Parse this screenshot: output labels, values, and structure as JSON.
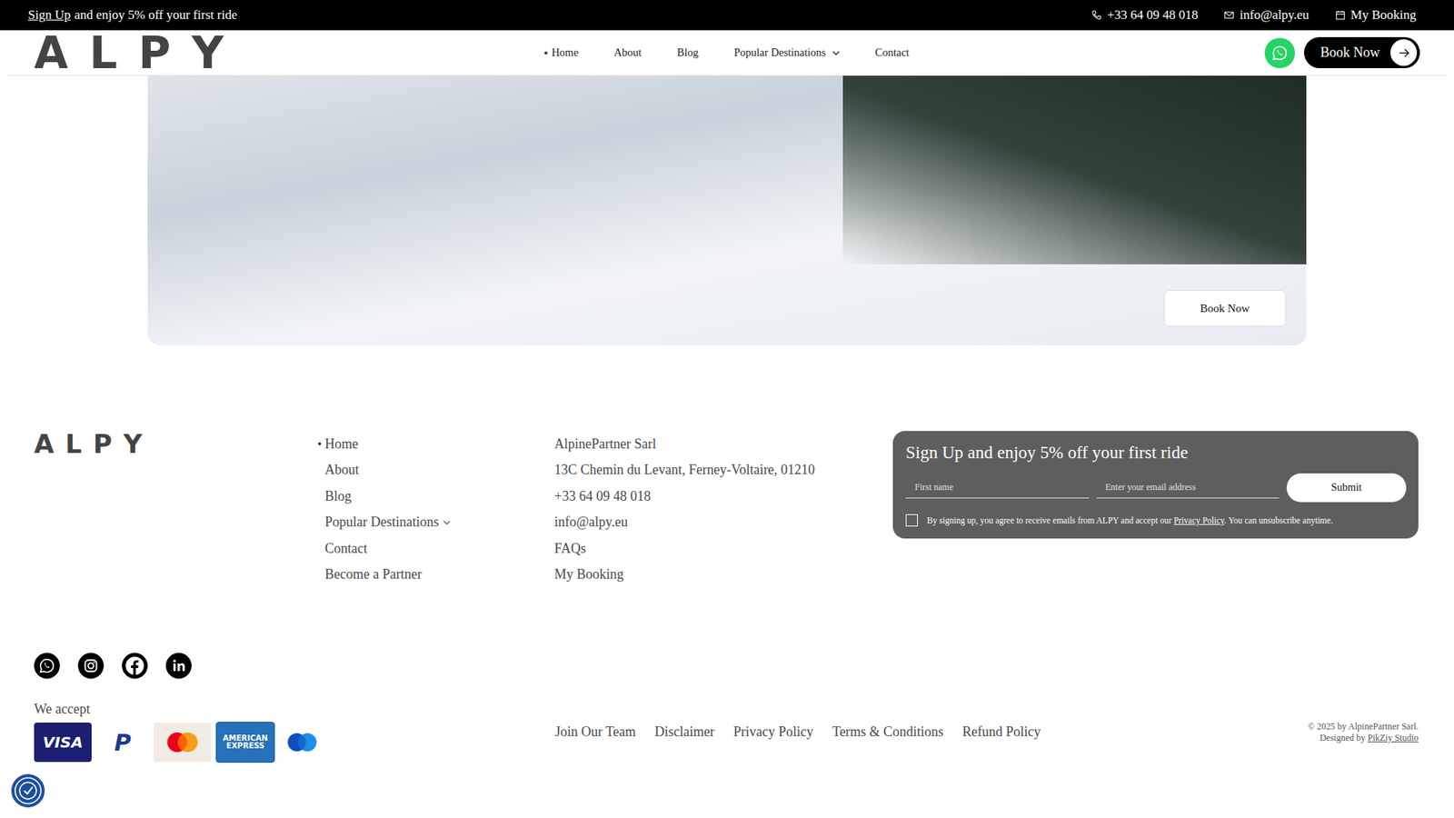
{
  "top_bar": {
    "promo_link": "Sign Up",
    "promo_text": "and enjoy 5% off your first ride",
    "contacts": [
      {
        "kind": "phone",
        "label": "+33 64 09 48 018"
      },
      {
        "kind": "mail",
        "label": "info@alpy.eu"
      },
      {
        "kind": "calendar",
        "label": "My Booking"
      }
    ]
  },
  "header": {
    "logo": "ALPY",
    "nav": [
      {
        "label": "Home",
        "selected": true,
        "dropdown": false
      },
      {
        "label": "About",
        "selected": false,
        "dropdown": false
      },
      {
        "label": "Blog",
        "selected": false,
        "dropdown": false
      },
      {
        "label": "Popular Destinations",
        "selected": false,
        "dropdown": true
      },
      {
        "label": "Contact",
        "selected": false,
        "dropdown": false
      }
    ],
    "book_button": "Book Now"
  },
  "hero": {
    "button": "Book Now"
  },
  "footer": {
    "logo": "ALPY",
    "nav": [
      {
        "label": "Home",
        "selected": true,
        "dropdown": false
      },
      {
        "label": "About",
        "selected": false,
        "dropdown": false
      },
      {
        "label": "Blog",
        "selected": false,
        "dropdown": false
      },
      {
        "label": "Popular Destinations",
        "selected": false,
        "dropdown": true
      },
      {
        "label": "Contact",
        "selected": false,
        "dropdown": false
      },
      {
        "label": "Become a Partner",
        "selected": false,
        "dropdown": false
      }
    ],
    "company": [
      "AlpinePartner Sarl",
      "13C Chemin du Levant, Ferney-Voltaire, 01210",
      "+33 64 09 48 018",
      "info@alpy.eu",
      "FAQs",
      "My Booking"
    ],
    "signup": {
      "title": "Sign Up and enjoy 5% off your first ride",
      "fields": [
        {
          "placeholder": "First name"
        },
        {
          "placeholder": "Enter your email address"
        }
      ],
      "submit": "Submit",
      "consent": {
        "checked": false,
        "text_before": "By signing up, you agree to receive emails from ALPY and accept our",
        "link": "Privacy Policy",
        "text_after": ". You can unsubscribe anytime."
      }
    },
    "payments": {
      "title": "We accept",
      "cards": [
        {
          "kind": "visa",
          "label": "VISA"
        },
        {
          "kind": "paypal",
          "label": "P"
        },
        {
          "kind": "mastercard"
        },
        {
          "kind": "amex",
          "label": "AMERICAN EXPRESS"
        },
        {
          "kind": "maestro"
        }
      ]
    },
    "legal_links": [
      "Join Our Team",
      "Disclaimer",
      "Privacy Policy",
      "Terms & Conditions",
      "Refund Policy"
    ],
    "copyright": "© 2025 by AlpinePartner Sarl.",
    "credit": {
      "text": "Designed by",
      "link": "PikZiy Studio"
    }
  }
}
